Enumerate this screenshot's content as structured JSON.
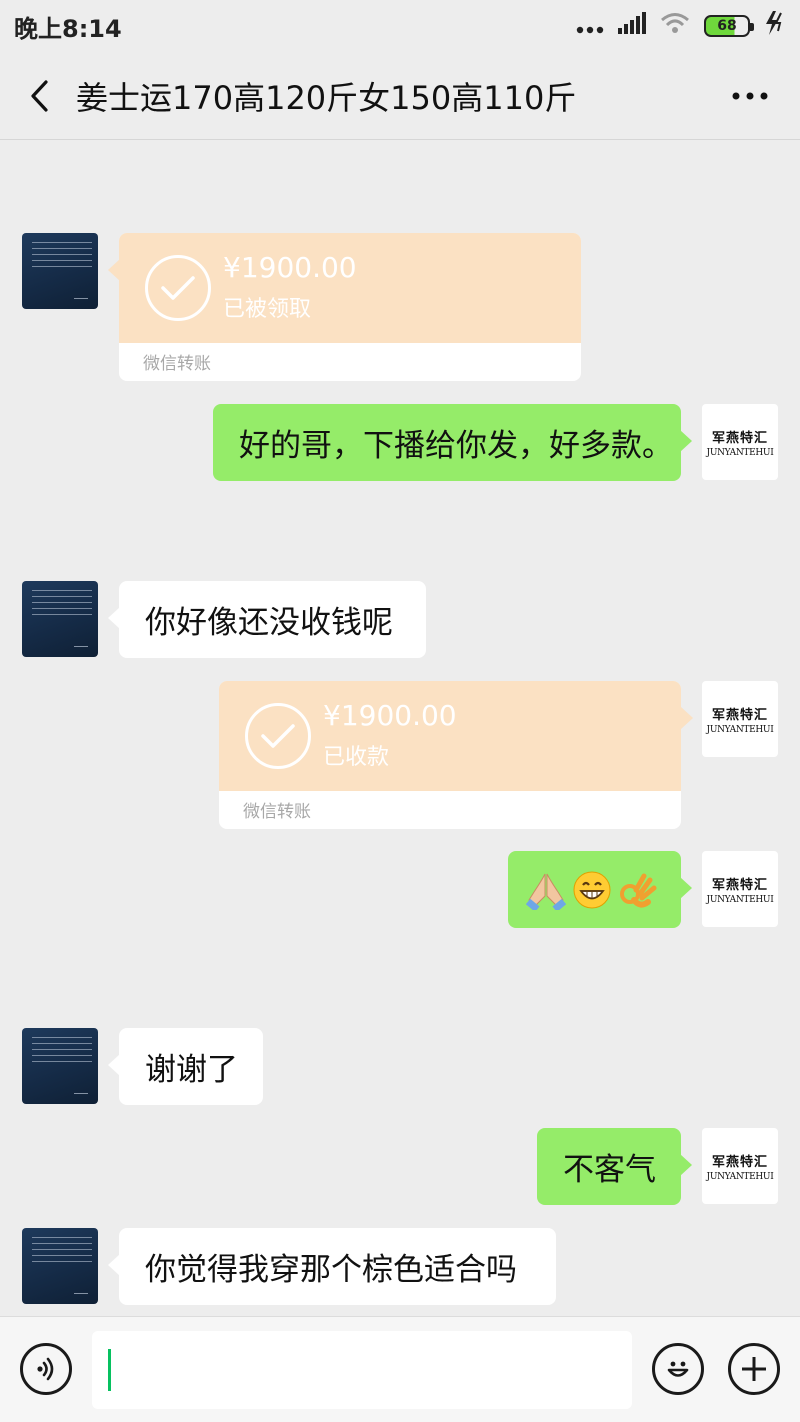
{
  "status_bar": {
    "time": "晚上8:14",
    "battery": "68"
  },
  "header": {
    "title": "姜士运170高120斤女150高110斤",
    "more": "···"
  },
  "avatars": {
    "right_brand_cn": "军燕特汇",
    "right_brand_en": "JUNYANTEHUI"
  },
  "messages": [
    {
      "side": "left",
      "type": "transfer",
      "amount": "¥1900.00",
      "status": "已被领取",
      "footer": "微信转账"
    },
    {
      "side": "right",
      "type": "text",
      "text": "好的哥，下播给你发，好多款。"
    },
    {
      "side": "left",
      "type": "text",
      "text": "你好像还没收钱呢"
    },
    {
      "side": "right",
      "type": "transfer",
      "amount": "¥1900.00",
      "status": "已收款",
      "footer": "微信转账"
    },
    {
      "side": "right",
      "type": "emoji",
      "emojis": [
        "folded-hands",
        "grinning-face",
        "ok-hand"
      ]
    },
    {
      "side": "left",
      "type": "text",
      "text": "谢谢了"
    },
    {
      "side": "right",
      "type": "text",
      "text": "不客气"
    },
    {
      "side": "left",
      "type": "text",
      "text": "你觉得我穿那个棕色适合吗"
    }
  ],
  "input_bar": {
    "value": "",
    "icons": [
      "voice-icon",
      "emoji-icon",
      "plus-icon"
    ]
  },
  "colors": {
    "background": "#ededed",
    "bubble_right": "#95ec69",
    "bubble_left": "#ffffff",
    "transfer": "#fbe1c3",
    "caret": "#07c160"
  }
}
